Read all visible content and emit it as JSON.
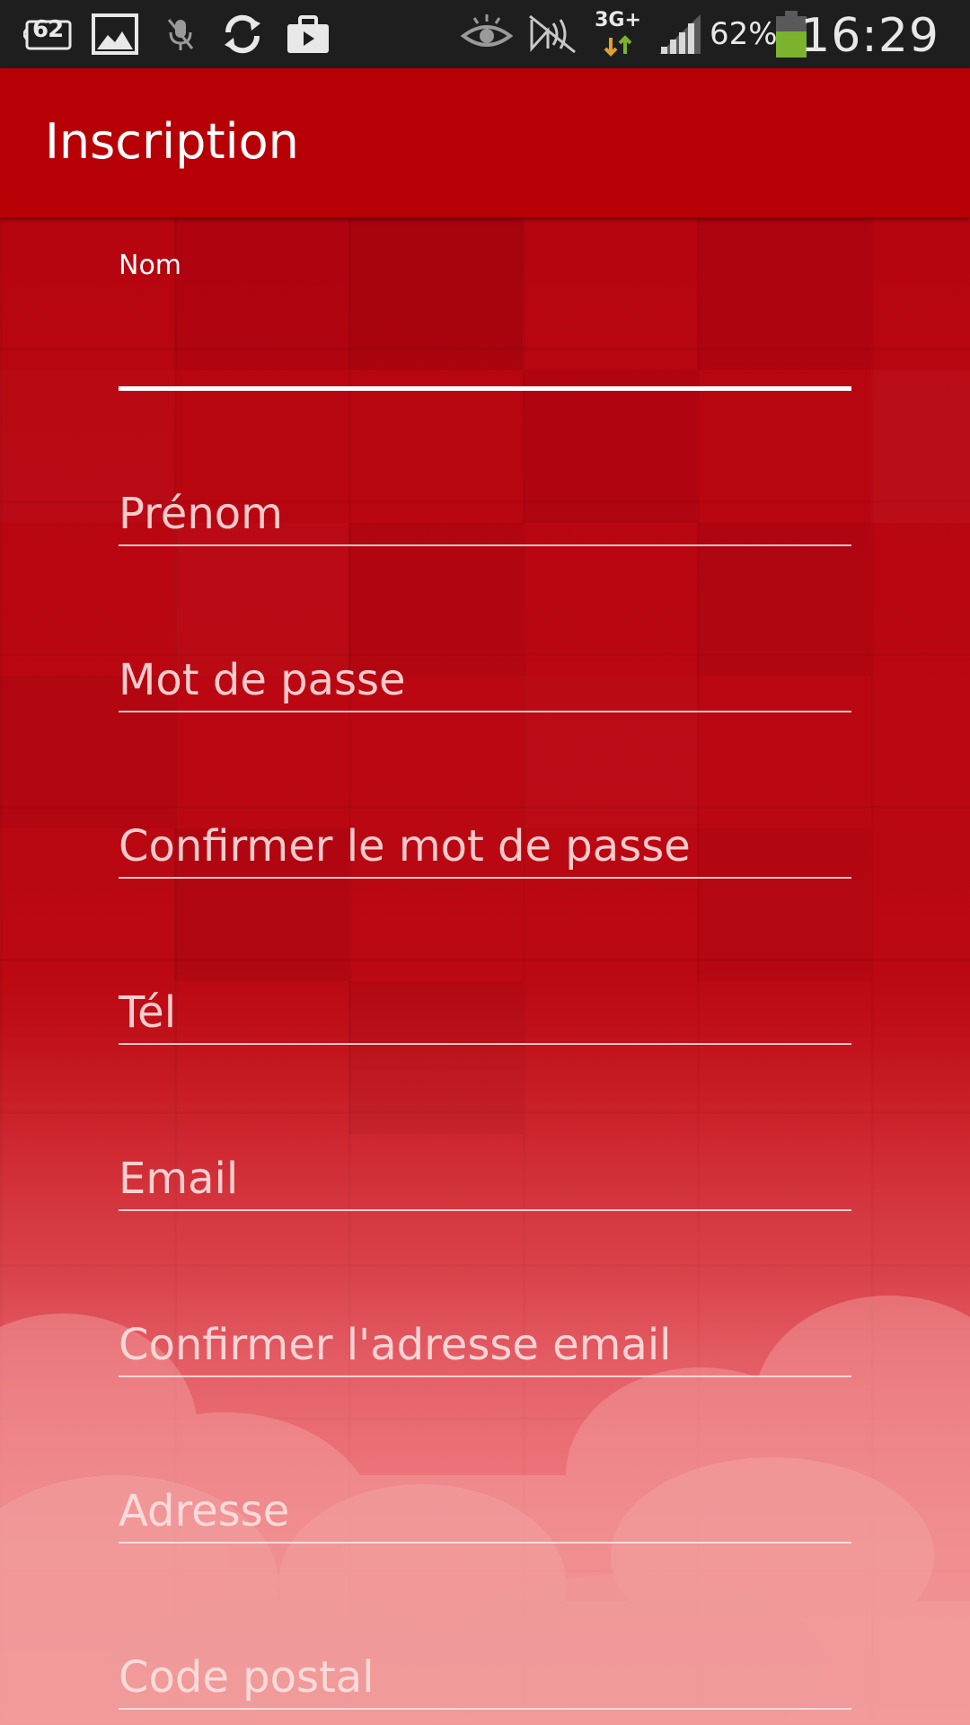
{
  "status_bar": {
    "notification_badge": "62",
    "network_type": "3G+",
    "battery_percent": "62%",
    "time": "16:29",
    "battery_level": 0.62,
    "icons": [
      "counter-badge-icon",
      "image-icon",
      "mic-muted-icon",
      "sync-icon",
      "briefcase-play-icon",
      "eye-icon",
      "nfc-muted-icon",
      "data-transfer-icon",
      "signal-icon",
      "battery-icon"
    ]
  },
  "app_bar": {
    "title": "Inscription"
  },
  "form": {
    "fields": [
      {
        "label": "Nom",
        "placeholder": "",
        "value": "",
        "focused": true
      },
      {
        "label": "",
        "placeholder": "Prénom",
        "value": ""
      },
      {
        "label": "",
        "placeholder": "Mot de passe",
        "value": ""
      },
      {
        "label": "",
        "placeholder": "Confirmer le mot de passe",
        "value": ""
      },
      {
        "label": "",
        "placeholder": "Tél",
        "value": ""
      },
      {
        "label": "",
        "placeholder": "Email",
        "value": ""
      },
      {
        "label": "",
        "placeholder": "Confirmer l'adresse email",
        "value": ""
      },
      {
        "label": "",
        "placeholder": "Adresse",
        "value": ""
      },
      {
        "label": "",
        "placeholder": "Code postal",
        "value": ""
      }
    ]
  },
  "colors": {
    "status_bar": "#1e1e1e",
    "app_bar": "#b70005",
    "background_top": "#b70510",
    "background_bottom": "#ee8a8c",
    "text": "#ffffff",
    "battery_fill": "#7bb32e"
  }
}
